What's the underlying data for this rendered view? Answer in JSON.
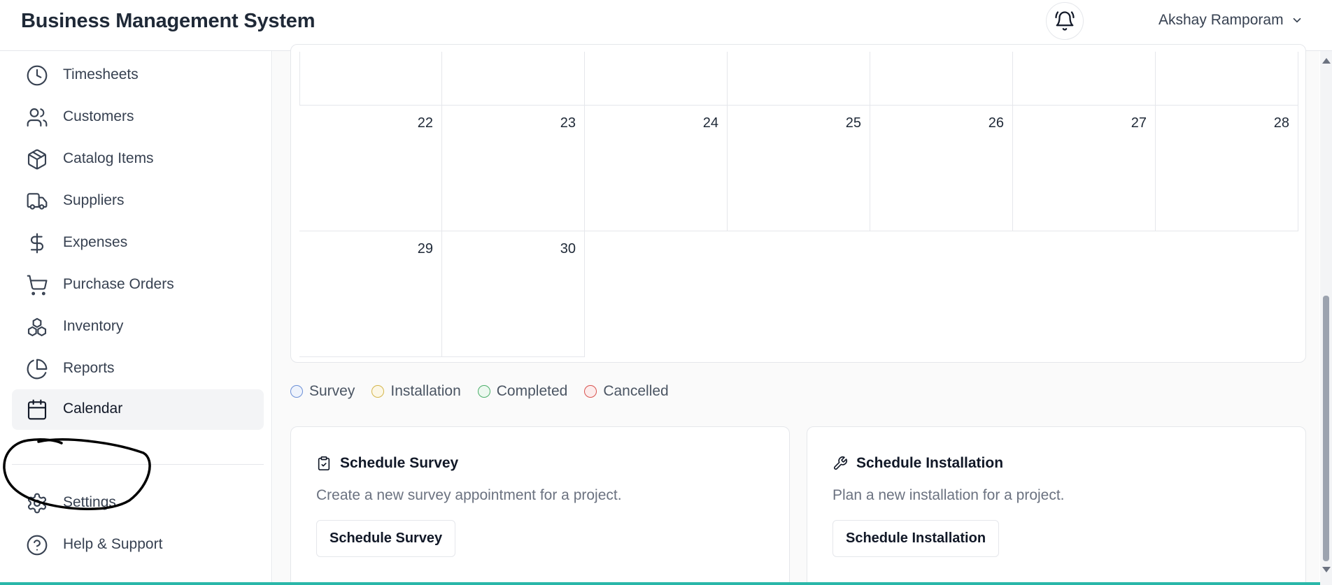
{
  "app": {
    "title": "Business Management System",
    "user_name": "Akshay Ramporam"
  },
  "sidebar": {
    "items": [
      {
        "label": "Timesheets",
        "icon": "clock-icon"
      },
      {
        "label": "Customers",
        "icon": "users-icon"
      },
      {
        "label": "Catalog Items",
        "icon": "package-icon"
      },
      {
        "label": "Suppliers",
        "icon": "truck-icon"
      },
      {
        "label": "Expenses",
        "icon": "dollar-icon"
      },
      {
        "label": "Purchase Orders",
        "icon": "cart-icon"
      },
      {
        "label": "Inventory",
        "icon": "boxes-icon"
      },
      {
        "label": "Reports",
        "icon": "pie-chart-icon"
      },
      {
        "label": "Calendar",
        "icon": "calendar-icon",
        "active": true
      }
    ],
    "footer_items": [
      {
        "label": "Settings",
        "icon": "gear-icon"
      },
      {
        "label": "Help & Support",
        "icon": "help-icon"
      }
    ]
  },
  "calendar": {
    "week_4": [
      "22",
      "23",
      "24",
      "25",
      "26",
      "27",
      "28"
    ],
    "week_5": [
      "29",
      "30"
    ]
  },
  "legend": [
    {
      "label": "Survey",
      "color": "#6b8fd6"
    },
    {
      "label": "Installation",
      "color": "#d4b54a"
    },
    {
      "label": "Completed",
      "color": "#4caf6a"
    },
    {
      "label": "Cancelled",
      "color": "#d9534f"
    }
  ],
  "actions": {
    "survey": {
      "title": "Schedule Survey",
      "description": "Create a new survey appointment for a project.",
      "button": "Schedule Survey",
      "icon": "clipboard-check-icon"
    },
    "installation": {
      "title": "Schedule Installation",
      "description": "Plan a new installation for a project.",
      "button": "Schedule Installation",
      "icon": "wrench-icon"
    }
  },
  "colors": {
    "accent": "#2ab7a9",
    "annotation": "#000000"
  }
}
